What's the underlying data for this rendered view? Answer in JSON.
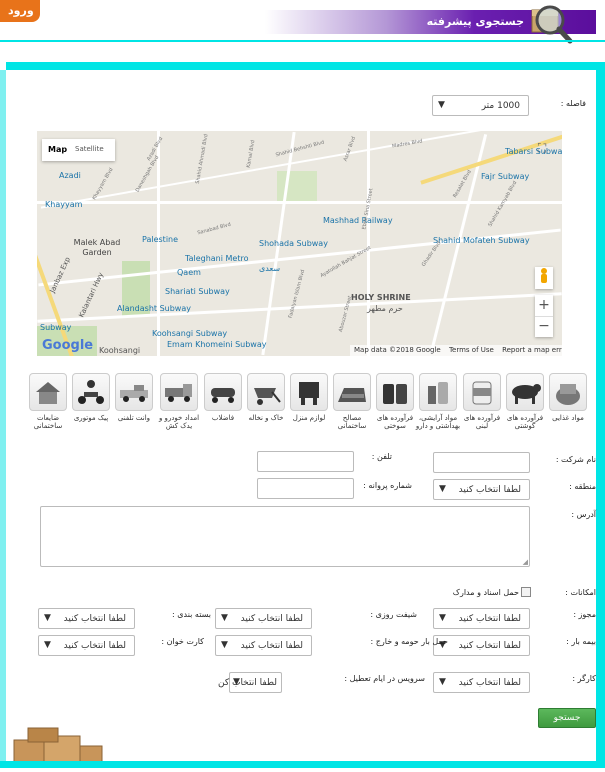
{
  "header": {
    "login_label": "ورود",
    "title": "جستجوی پیشرفته"
  },
  "distance": {
    "label": "فاصله :",
    "value": "1000 متر"
  },
  "map": {
    "tab_map": "Map",
    "tab_satellite": "Satellite",
    "attribution": "Map data ©2018 Google",
    "terms": "Terms of Use",
    "report": "Report a map error",
    "logo": "Google",
    "places": [
      "Azadi",
      "Khayyam",
      "Malek Abad Garden",
      "Palestine",
      "Taleghani Metro",
      "Qaem",
      "Shariati Subway",
      "Alandasht Subway",
      "Koohsangi Subway",
      "Emam Khomeini Subway",
      "Koohsangi",
      "Shohada Subway",
      "سعدی",
      "Mashhad Railway",
      "Shahid Mofateh Subway",
      "Fajr Subway",
      "Tabarsi Subway",
      "HOLY SHRINE",
      "حرم مطهر",
      "Subway",
      "Kalantari Hwy",
      "Janbaz Exp"
    ],
    "streets": [
      "Khayyam Blvd",
      "Daneshgah Blvd",
      "Azadi Blvd",
      "Shahid Ahmadi Blvd",
      "Kamal Blvd",
      "Shahid Behshti Blvd",
      "Sanabad Blvd",
      "Fadaiyan Islam Blvd",
      "Asrar Blvd",
      "Madres Blvd",
      "Ayatollah Bahjat Street",
      "Abouzar Street",
      "Ghadir Blvd",
      "Resalat Blvd",
      "Ebne Sina Street",
      "Shahid Kamyab Blvd"
    ]
  },
  "categories": [
    {
      "label": "مواد غذایی",
      "icon": "food-icon"
    },
    {
      "label": "فرآورده های گوشتی",
      "icon": "meat-products-icon"
    },
    {
      "label": "فرآورده های لبنی",
      "icon": "dairy-products-icon"
    },
    {
      "label": "مواد آرایشی، بهداشتی و دارو",
      "icon": "cosmetics-icon"
    },
    {
      "label": "فرآورده های سوختی",
      "icon": "fuel-products-icon"
    },
    {
      "label": "مصالح ساختمانی",
      "icon": "building-materials-icon"
    },
    {
      "label": "لوازم منزل",
      "icon": "home-appliances-icon"
    },
    {
      "label": "خاک و نخاله",
      "icon": "soil-debris-icon"
    },
    {
      "label": "فاضلاب",
      "icon": "sewage-icon"
    },
    {
      "label": "امداد خودرو و یدک کش",
      "icon": "tow-truck-icon"
    },
    {
      "label": "وانت تلفنی",
      "icon": "pickup-truck-icon"
    },
    {
      "label": "پیک موتوری",
      "icon": "motorcycle-courier-icon"
    },
    {
      "label": "ضایعات ساختمانی",
      "icon": "construction-waste-icon"
    }
  ],
  "form": {
    "company_label": "نام شرکت :",
    "phone_label": "تلفن :",
    "region_label": "منطقه :",
    "license_label": "شماره پروانه :",
    "address_label": "آدرس :",
    "facilities_label": "امکانات :",
    "docs_checkbox_label": "حمل اسناد و مدارک",
    "permit_label": "مجوز :",
    "shift_label": "شیفت روزی :",
    "packing_label": "بسته بندی :",
    "insurance_label": "بیمه بار :",
    "transport_label": "حمل بار حومه و خارج :",
    "card_label": "کارت خوان :",
    "worker_label": "کارگر :",
    "holiday_label": "سرویس در ایام تعطیل :",
    "select_placeholder": "لطفا انتخاب کنید",
    "select_placeholder_short": "لطفا انتخاب کن",
    "search_button": "جستجو"
  },
  "colors": {
    "header_purple": "#5b0e9c",
    "cyan": "#00e5e5",
    "orange": "#e8731a",
    "button_green": "#43a047"
  }
}
